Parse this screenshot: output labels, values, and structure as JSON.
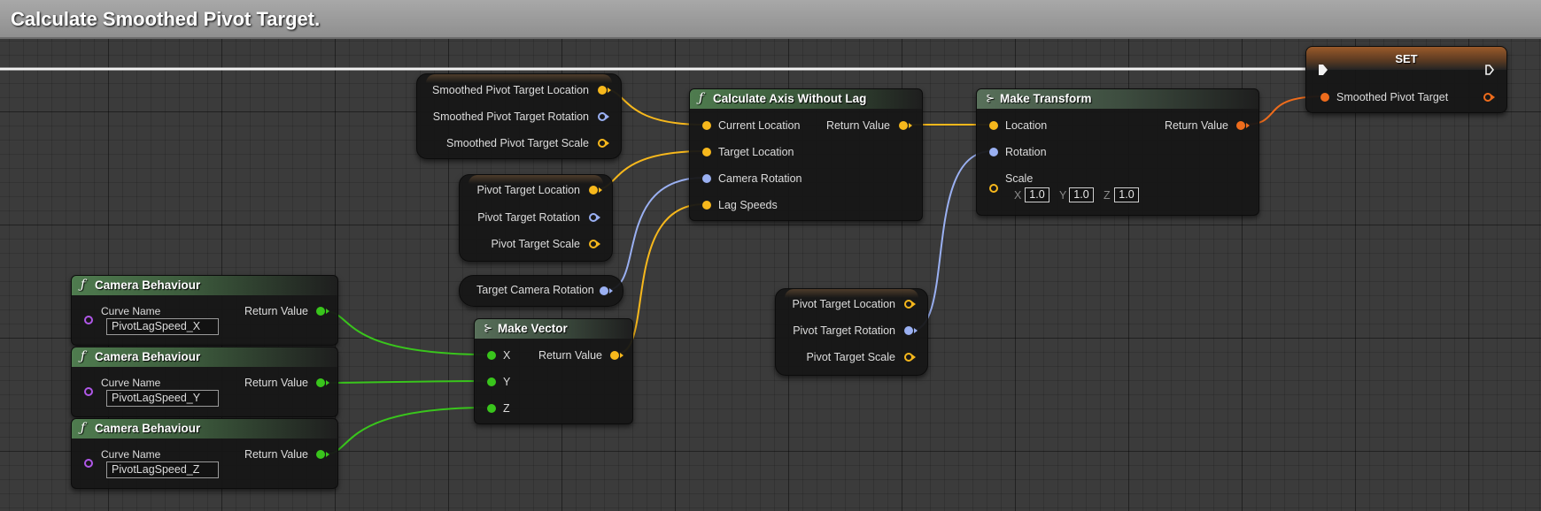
{
  "comment": {
    "title": "Calculate Smoothed Pivot Target."
  },
  "colors": {
    "vector_pin": "#f7b81c",
    "rotator_pin": "#9ab0f2",
    "float_pin": "#39c51c",
    "transform_pin": "#ee6c1c",
    "name_pin": "#b058e8"
  },
  "nodes": {
    "smoothed_pivot_break": {
      "pins": [
        "Smoothed Pivot Target Location",
        "Smoothed Pivot Target Rotation",
        "Smoothed Pivot Target Scale"
      ]
    },
    "pivot_target_break": {
      "pins": [
        "Pivot Target Location",
        "Pivot Target Rotation",
        "Pivot Target Scale"
      ]
    },
    "target_camera_rotation": {
      "label": "Target Camera Rotation"
    },
    "calc_axis": {
      "icon": "function-icon",
      "title": "Calculate Axis Without Lag",
      "inputs": [
        "Current Location",
        "Target Location",
        "Camera Rotation",
        "Lag Speeds"
      ],
      "output": "Return Value"
    },
    "make_transform": {
      "icon": "pure-function-icon",
      "title": "Make Transform",
      "inputs": [
        "Location",
        "Rotation",
        "Scale"
      ],
      "scale_axes": [
        "X",
        "Y",
        "Z"
      ],
      "scale_values": [
        "1.0",
        "1.0",
        "1.0"
      ],
      "output": "Return Value"
    },
    "set_node": {
      "title": "SET",
      "input": "Smoothed Pivot Target"
    },
    "pivot_target_break_2": {
      "pins": [
        "Pivot Target Location",
        "Pivot Target Rotation",
        "Pivot Target Scale"
      ]
    },
    "camera_behaviour_x": {
      "icon": "function-icon",
      "title": "Camera Behaviour",
      "input_label": "Curve Name",
      "curve_name": "PivotLagSpeed_X",
      "output": "Return Value"
    },
    "camera_behaviour_y": {
      "icon": "function-icon",
      "title": "Camera Behaviour",
      "input_label": "Curve Name",
      "curve_name": "PivotLagSpeed_Y",
      "output": "Return Value"
    },
    "camera_behaviour_z": {
      "icon": "function-icon",
      "title": "Camera Behaviour",
      "input_label": "Curve Name",
      "curve_name": "PivotLagSpeed_Z",
      "output": "Return Value"
    },
    "make_vector": {
      "icon": "pure-function-icon",
      "title": "Make Vector",
      "inputs": [
        "X",
        "Y",
        "Z"
      ],
      "output": "Return Value"
    }
  }
}
